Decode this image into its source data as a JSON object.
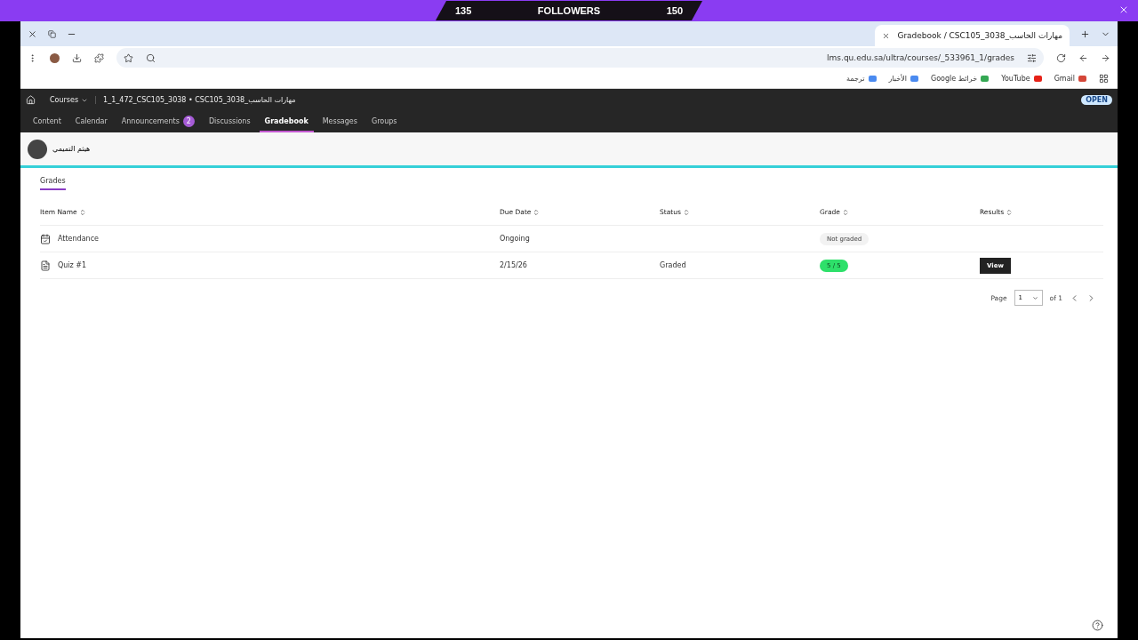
{
  "overlay": {
    "left_count": "135",
    "title": "FOLLOWERS",
    "right_count": "150"
  },
  "browser": {
    "tab_title": "Gradebook / CSC105_3038_مهارات الحاسب",
    "url": "lms.qu.edu.sa/ultra/courses/_533961_1/grades",
    "bookmarks": [
      "ترجمة",
      "الأخبار",
      "Google خرائط",
      "YouTube",
      "Gmail"
    ]
  },
  "course": {
    "menu_label": "Courses",
    "title": "1_1_472_CSC105_3038 • CSC105_3038_مهارات الحاسب",
    "status_badge": "OPEN"
  },
  "nav_tabs": [
    {
      "label": "Content",
      "selected": false
    },
    {
      "label": "Calendar",
      "selected": false
    },
    {
      "label": "Announcements",
      "selected": false,
      "badge": "2"
    },
    {
      "label": "Discussions",
      "selected": false
    },
    {
      "label": "Gradebook",
      "selected": true
    },
    {
      "label": "Messages",
      "selected": false
    },
    {
      "label": "Groups",
      "selected": false
    }
  ],
  "user": {
    "name": "هيثم التميمي"
  },
  "sub_tabs": [
    {
      "label": "Grades",
      "selected": true
    }
  ],
  "table": {
    "columns": [
      "Item Name",
      "Due Date",
      "Status",
      "Grade",
      "Results"
    ],
    "rows": [
      {
        "kind": "attendance",
        "name": "Attendance",
        "due": "Ongoing",
        "grade": "Not graded",
        "graded": false
      },
      {
        "kind": "quiz",
        "name": "Quiz #1",
        "due": "2/15/26",
        "status": "Graded",
        "grade": "5 / 5",
        "graded": true,
        "result": "View"
      }
    ]
  },
  "pagination": {
    "label": "Page",
    "page": "1",
    "of": "of 1"
  }
}
